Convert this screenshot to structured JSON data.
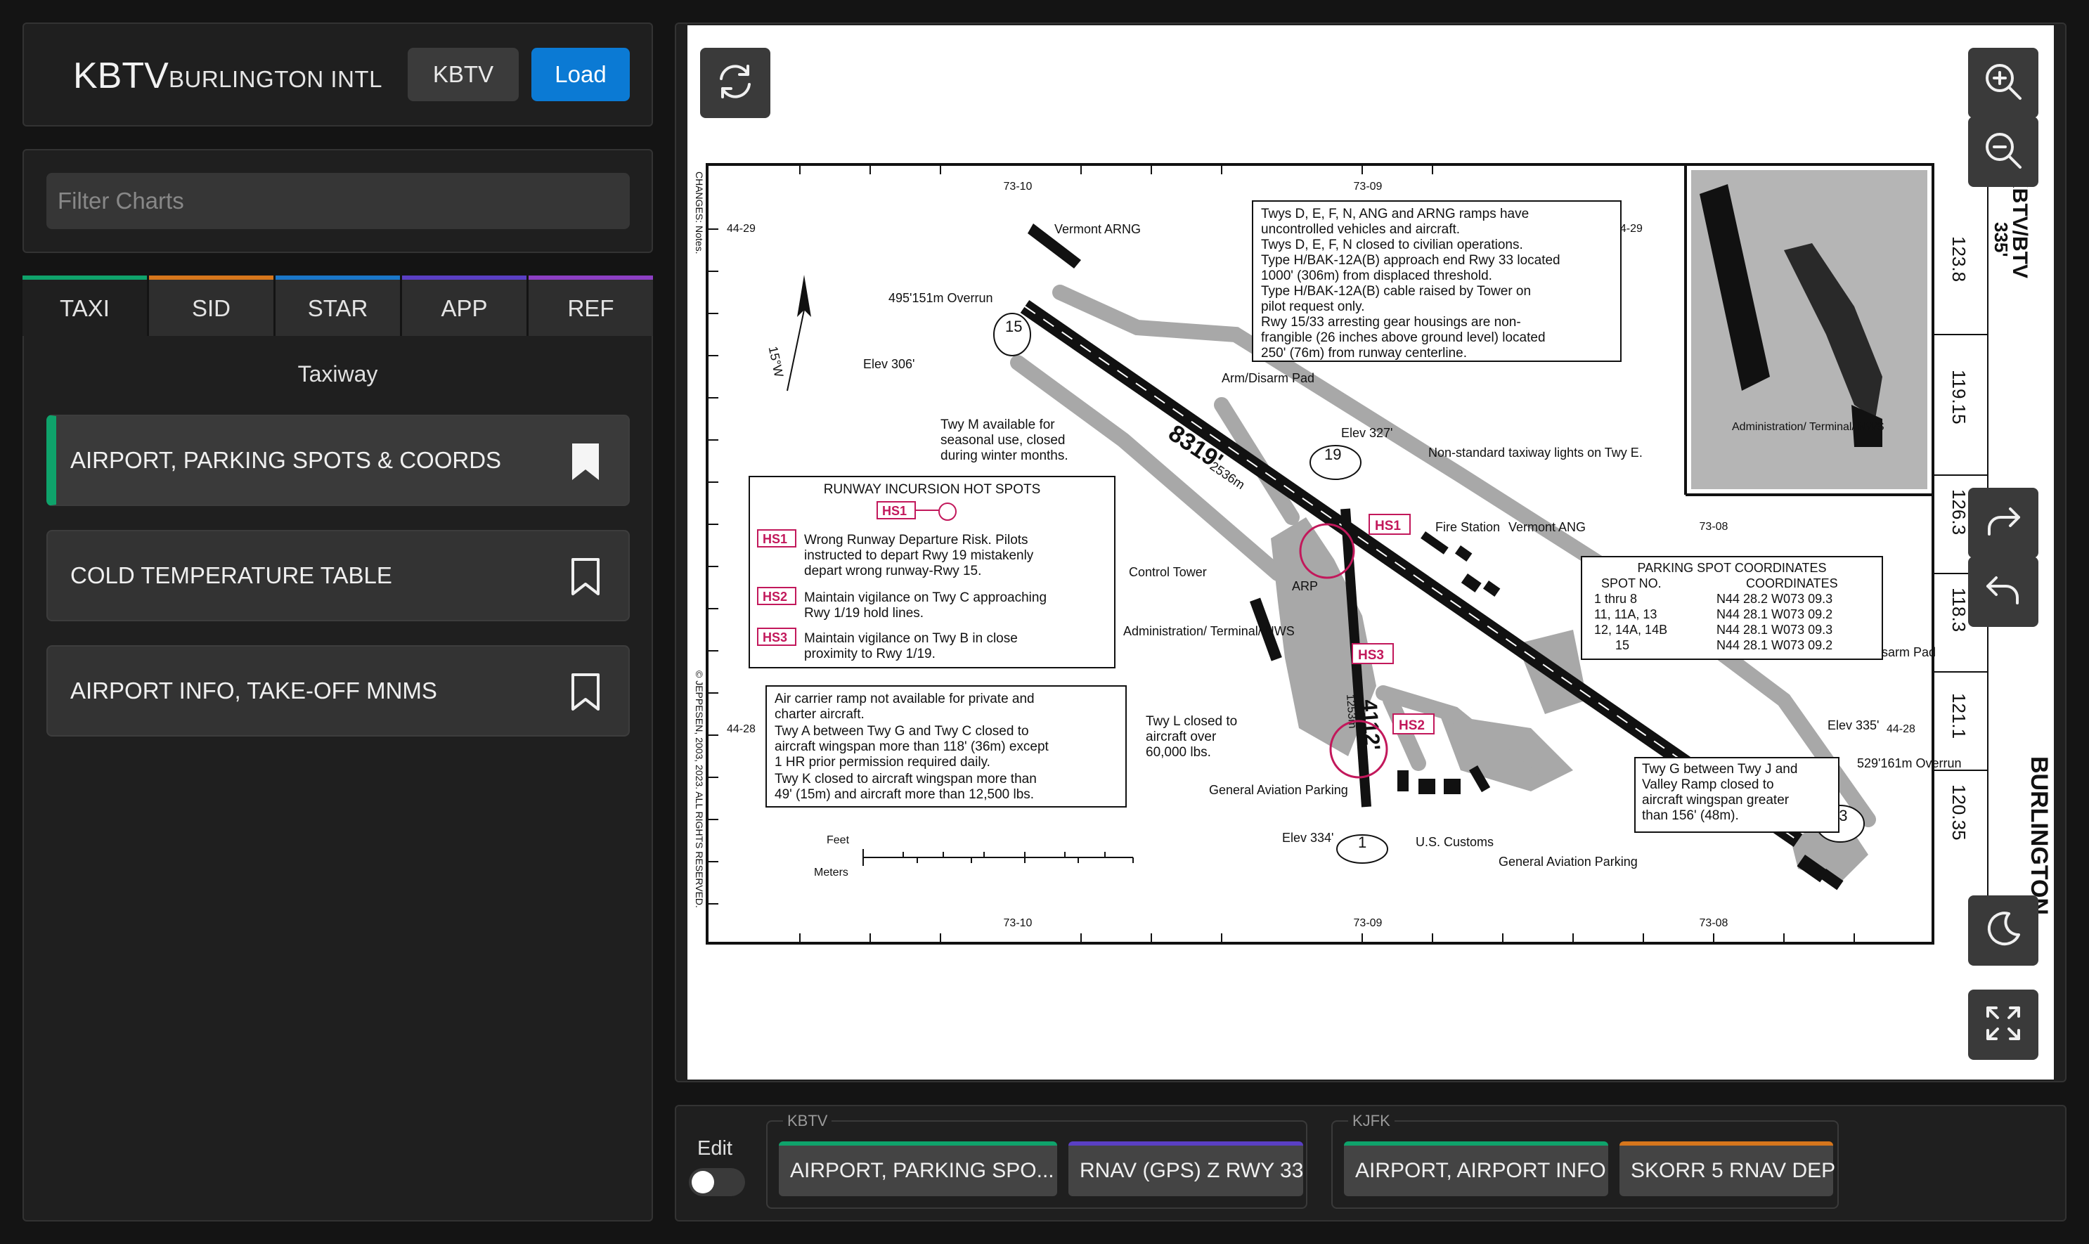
{
  "header": {
    "icao": "KBTV",
    "airport_name": "BURLINGTON INTL",
    "icao_button": "KBTV",
    "load_button": "Load"
  },
  "filter": {
    "placeholder": "Filter Charts"
  },
  "tabs": [
    {
      "label": "TAXI",
      "color": "#0fa36b"
    },
    {
      "label": "SID",
      "color": "#d6761c"
    },
    {
      "label": "STAR",
      "color": "#1b77c9"
    },
    {
      "label": "APP",
      "color": "#5a3fc4"
    },
    {
      "label": "REF",
      "color": "#8d3fc4"
    }
  ],
  "list": {
    "section": "Taxiway",
    "items": [
      {
        "label": "AIRPORT, PARKING SPOTS & COORDS",
        "bookmarked": true
      },
      {
        "label": "COLD TEMPERATURE TABLE",
        "bookmarked": false
      },
      {
        "label": "AIRPORT INFO, TAKE-OFF MNMS",
        "bookmarked": false
      }
    ]
  },
  "chart": {
    "lat_top": "44-29",
    "lat_bottom": "44-28",
    "lon_left": "73-10",
    "lon_mid": "73-09",
    "lon_right": "73-08",
    "side_freqs": [
      "123.8",
      "119.15",
      "126.3",
      "118.3",
      "121.1",
      "120.35"
    ],
    "side_title": "KBTV/BTV",
    "side_name": "BURLINGTON",
    "side_elev": "335'",
    "notes_top": [
      "Twys D, E, F, N, ANG and ARNG ramps have",
      "uncontrolled vehicles and aircraft.",
      "Twys D, E, F, N closed to civilian operations.",
      "Type H/BAK-12A(B) approach end Rwy 33 located",
      "1000' (306m) from displaced threshold.",
      "Type H/BAK-12A(B) cable raised by Tower on",
      "pilot request only.",
      "Rwy 15/33 arresting gear housings are non-",
      "frangible (26 inches above ground level) located",
      "250' (76m) from runway centerline."
    ],
    "hotspots_title": "RUNWAY INCURSION HOT SPOTS",
    "hotspots": [
      {
        "id": "HS1",
        "text1": "Wrong Runway Departure Risk. Pilots",
        "text2": "instructed to depart Rwy 19 mistakenly",
        "text3": "depart wrong runway-Rwy 15."
      },
      {
        "id": "HS2",
        "text1": "Maintain vigilance on Twy C approaching",
        "text2": "Rwy 1/19 hold lines.",
        "text3": ""
      },
      {
        "id": "HS3",
        "text1": "Maintain vigilance on Twy B in close",
        "text2": "proximity to Rwy 1/19.",
        "text3": ""
      }
    ],
    "notes_bottom": [
      "Air carrier ramp not available for private and",
      "charter aircraft.",
      "Twy A between Twy G and Twy C closed to",
      "aircraft wingspan more than 118' (36m) except",
      "1 HR prior permission required daily.",
      "Twy K closed to aircraft wingspan more than",
      "49' (15m) and aircraft more than 12,500 lbs."
    ],
    "parking_title": "PARKING SPOT COORDINATES",
    "parking_head": [
      "SPOT NO.",
      "COORDINATES"
    ],
    "parking_rows": [
      [
        "1 thru 8",
        "N44 28.2 W073 09.3"
      ],
      [
        "11, 11A, 13",
        "N44 28.1 W073 09.2"
      ],
      [
        "12, 14A, 14B",
        "N44 28.1 W073 09.3"
      ],
      [
        "15",
        "N44 28.1 W073 09.2"
      ]
    ],
    "twy_g_note": [
      "Twy G between Twy J and",
      "Valley Ramp closed to",
      "aircraft wingspan greater",
      "than 156' (48m)."
    ],
    "twy_m_note": [
      "Twy M available for",
      "seasonal use, closed",
      "during winter months."
    ],
    "twy_l_note": [
      "Twy L closed to",
      "aircraft over",
      "60,000 lbs."
    ],
    "runway_main": "8319'",
    "runway_main_m": "2536m",
    "runway_cross": "4112'",
    "runway_cross_m": "1253m",
    "labels": {
      "vermont_arng": "Vermont ARNG",
      "vermont_ang": "Vermont ANG",
      "overrun_top": "495'151m Overrun",
      "overrun_bottom": "529'161m Overrun",
      "elev_306": "Elev 306'",
      "elev_327": "Elev 327'",
      "elev_335": "Elev 335'",
      "elev_334": "Elev 334'",
      "control_tower": "Control Tower",
      "admin": "Administration/ Terminal/ NWS",
      "fire": "Fire Station",
      "arp": "ARP",
      "nonstd": "Non-standard taxiway lights on Twy E.",
      "arm_disarm": "Arm/Disarm Pad",
      "customs": "U.S. Customs",
      "ga_parking": "General Aviation Parking",
      "feet": "Feet",
      "meters": "Meters",
      "copyright": "© JEPPESEN, 2003, 2023. ALL RIGHTS RESERVED.",
      "changes": "CHANGES: Notes."
    }
  },
  "bottom": {
    "edit_label": "Edit",
    "groups": [
      {
        "airport": "KBTV",
        "favorites": [
          {
            "label": "AIRPORT, PARKING SPO...",
            "color": "#0fa36b"
          },
          {
            "label": "RNAV (GPS) Z RWY 33",
            "color": "#5a3fc4"
          }
        ]
      },
      {
        "airport": "KJFK",
        "favorites": [
          {
            "label": "AIRPORT, AIRPORT INFO",
            "color": "#0fa36b"
          },
          {
            "label": "SKORR 5 RNAV DEP",
            "color": "#d6761c"
          }
        ]
      }
    ]
  },
  "icons": [
    "refresh-icon",
    "zoom-in-icon",
    "zoom-out-icon",
    "redo-icon",
    "undo-icon",
    "moon-icon",
    "fullscreen-icon",
    "bookmark-icon"
  ]
}
